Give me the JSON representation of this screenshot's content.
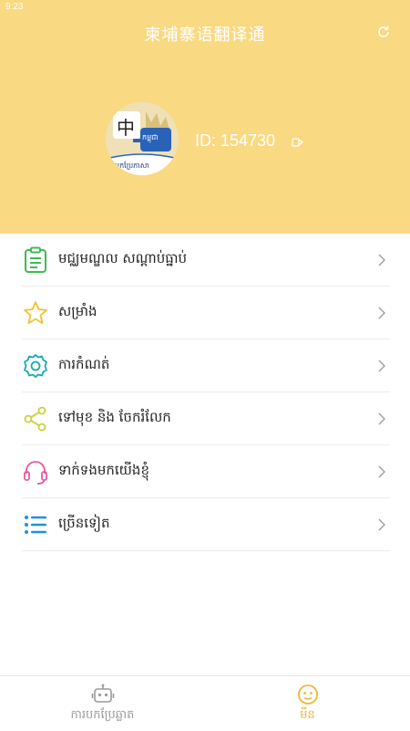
{
  "status": {
    "time": "9:23"
  },
  "header": {
    "title": "柬埔寨语翻译通",
    "refresh_icon": "refresh-icon",
    "avatar": {
      "badge_char": "中",
      "badge_text": "កម្ពុជា",
      "caption": "បកប្រែភាសា"
    },
    "user_id": "ID:  154730"
  },
  "menu": [
    {
      "name": "history",
      "label": "មជ្ឈមណ្ឌល សណ្ដាប់ធ្នាប់",
      "icon": "clipboard-icon",
      "color": "#3dbb55"
    },
    {
      "name": "favorites",
      "label": "សម្រាំង",
      "icon": "star-icon",
      "color": "#f2c233"
    },
    {
      "name": "settings",
      "label": "ការកំណត់",
      "icon": "gear-icon",
      "color": "#19a9b6"
    },
    {
      "name": "share",
      "label": "ទៅមុខ និង ចែករំលែក",
      "icon": "share-icon",
      "color": "#c9d13a"
    },
    {
      "name": "contact",
      "label": "ទាក់ទងមកយើងខ្ញុំ",
      "icon": "headset-icon",
      "color": "#e25da0"
    },
    {
      "name": "more",
      "label": "ច្រើនទៀត",
      "icon": "list-icon",
      "color": "#1f8fe5"
    }
  ],
  "tabbar": {
    "tabs": [
      {
        "label": "ការបកប្រែឆ្លាត",
        "icon": "robot-icon",
        "active": false
      },
      {
        "label": "មីន",
        "icon": "smiley-icon",
        "active": true
      }
    ],
    "active_color": "#f2b63a",
    "inactive_color": "#9a9a9a"
  }
}
